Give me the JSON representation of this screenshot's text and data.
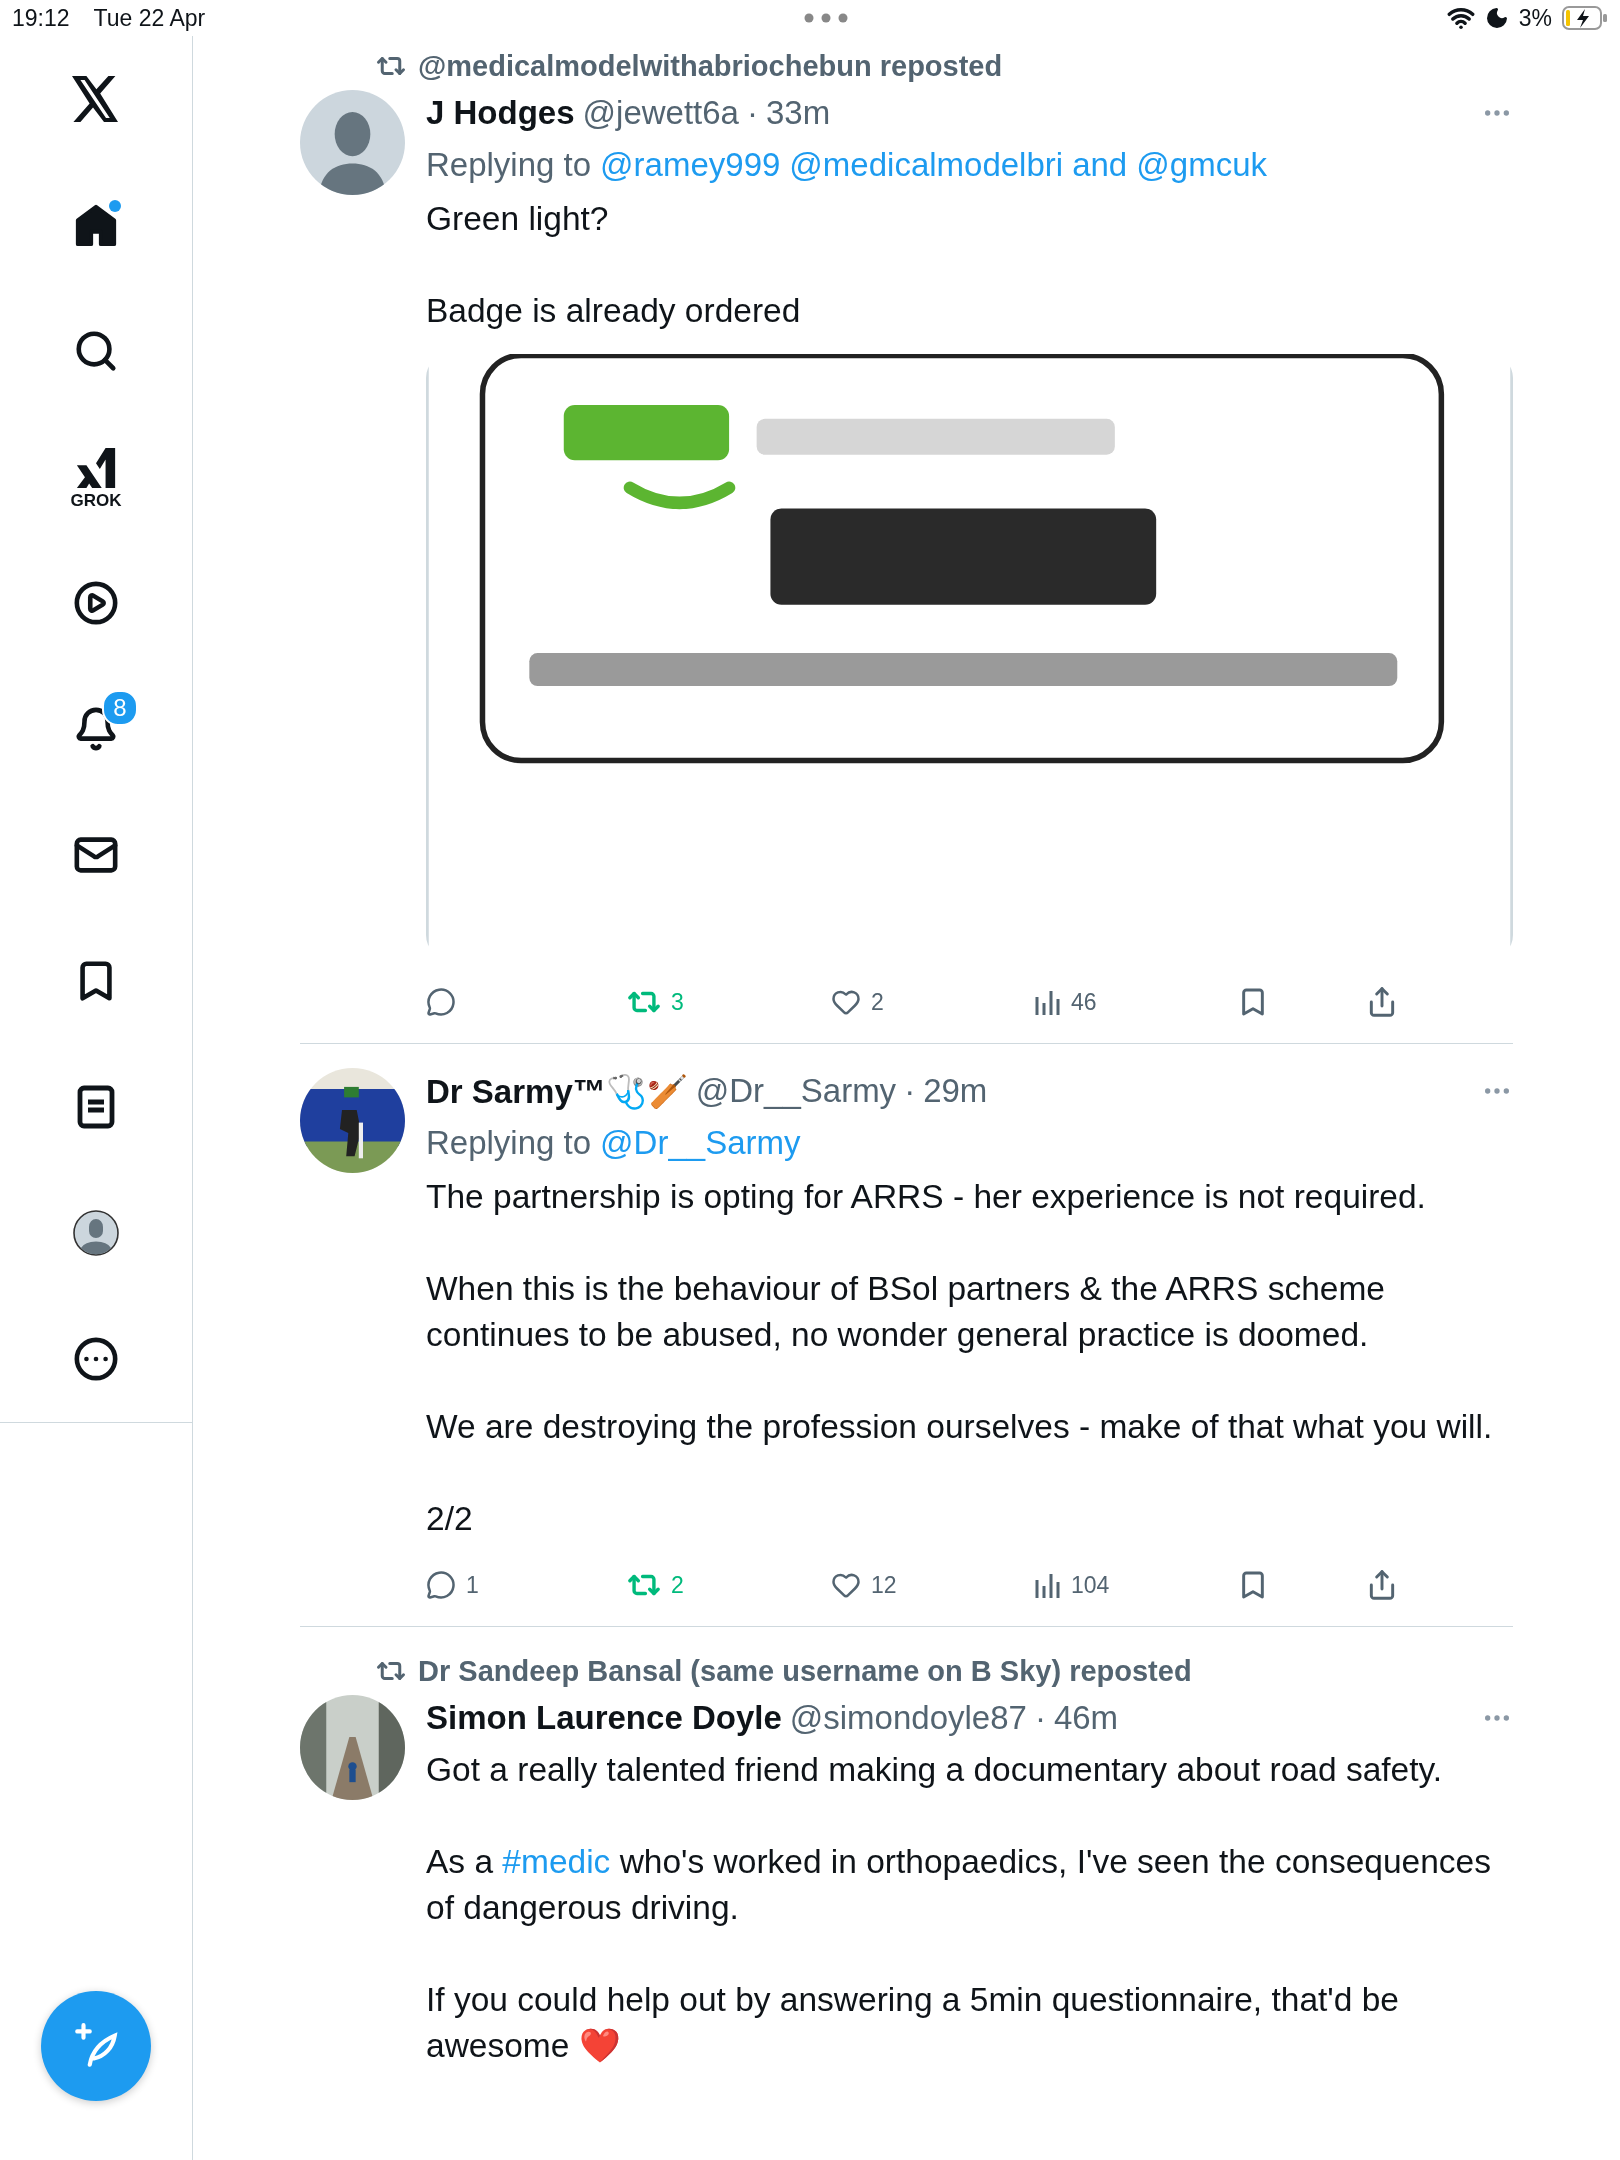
{
  "status_bar": {
    "time": "19:12",
    "date": "Tue 22 Apr",
    "battery": "3%"
  },
  "sidebar": {
    "logo": {
      "kind": "x"
    },
    "items": [
      {
        "kind": "home",
        "selected": true,
        "dot": true
      },
      {
        "kind": "search",
        "selected": false
      },
      {
        "kind": "grok",
        "selected": false,
        "label": "GROK"
      },
      {
        "kind": "video",
        "selected": false
      },
      {
        "kind": "notifications",
        "selected": false,
        "badge": "8"
      },
      {
        "kind": "messages",
        "selected": false
      },
      {
        "kind": "bookmarks",
        "selected": false
      },
      {
        "kind": "lists",
        "selected": false
      },
      {
        "kind": "profile",
        "selected": false
      },
      {
        "kind": "more",
        "selected": false
      }
    ],
    "compose": {
      "kind": "compose"
    }
  },
  "tweets": [
    {
      "reposted_by": "@medicalmodelwithabriochebun reposted",
      "avatar": {
        "kind": "figure"
      },
      "name": "J Hodges",
      "handle": "@jewett6a",
      "separator": "·",
      "time": "33m",
      "replying": {
        "prefix": "Replying to",
        "mentions": [
          "@ramey999",
          "@medicalmodelbri",
          "and @gmcuk"
        ]
      },
      "paragraphs": [
        [
          {
            "text": "Green light?"
          }
        ],
        [
          {
            "text": "Badge is already ordered"
          }
        ]
      ],
      "media": {
        "kind": "picture"
      },
      "actions": {
        "retweets": "3",
        "retweeted": true,
        "likes": "2",
        "liked": false,
        "views": "46"
      }
    },
    {
      "avatar": {
        "kind": "picture"
      },
      "name": "Dr Sarmy™🩺🏏",
      "handle": "@Dr__Sarmy",
      "separator": "·",
      "time": "29m",
      "replying": {
        "prefix": "Replying to",
        "mentions": [
          "@Dr__Sarmy"
        ]
      },
      "paragraphs": [
        [
          {
            "text": "The partnership is opting for ARRS - her experience is not required."
          }
        ],
        [
          {
            "text": "When this is the behaviour of BSol partners & the ARRS scheme continues to be abused, no wonder general practice is doomed."
          }
        ],
        [
          {
            "text": "We are destroying the profession ourselves - make of that what you will."
          }
        ],
        [
          {
            "text": "2/2"
          }
        ]
      ],
      "actions": {
        "replies": "1",
        "retweets": "2",
        "retweeted": true,
        "likes": "12",
        "liked": false,
        "views": "104"
      }
    },
    {
      "reposted_by": "Dr Sandeep Bansal (same username on B Sky) reposted",
      "avatar": {
        "kind": "picture"
      },
      "name": "Simon Laurence Doyle",
      "handle": "@simondoyle87",
      "separator": "·",
      "time": "46m",
      "paragraphs": [
        [
          {
            "text": "Got a really talented friend making a documentary about road safety."
          }
        ],
        [
          {
            "text": "As a "
          },
          {
            "text": "#medic",
            "link": true
          },
          {
            "text": " who's worked in orthopaedics, I've seen the consequences of dangerous driving."
          }
        ],
        [
          {
            "text": "If you could help out by answering a 5min questionnaire, that'd be awesome ❤️"
          }
        ]
      ]
    }
  ]
}
